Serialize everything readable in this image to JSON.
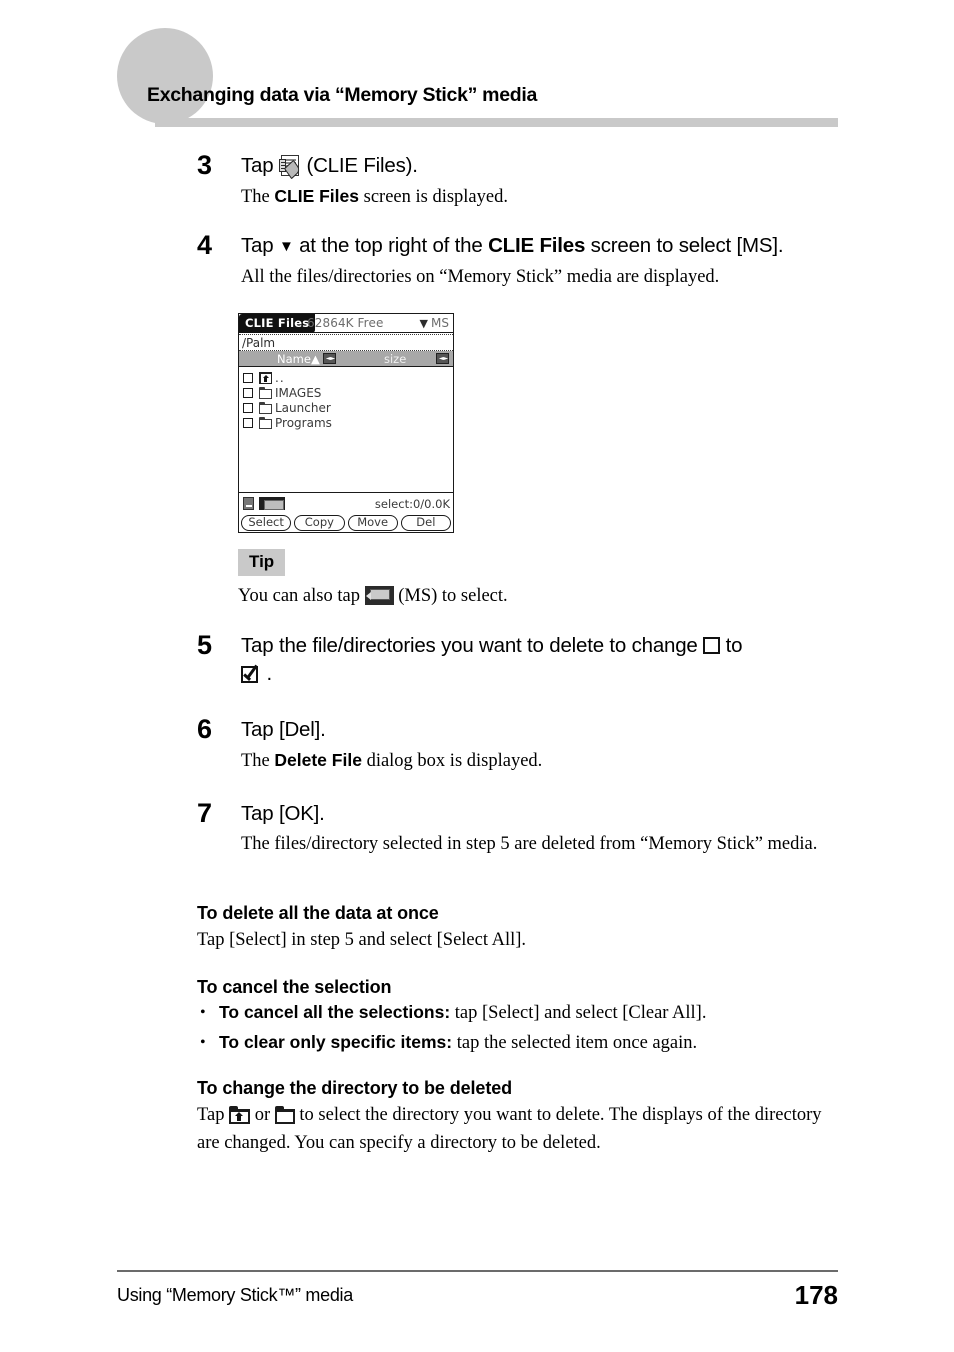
{
  "header": {
    "title": "Exchanging data via “Memory Stick” media"
  },
  "steps": [
    {
      "number": "3",
      "head_pre": "Tap",
      "head_post": "(CLIE Files).",
      "desc_pre": "The ",
      "desc_bold": "CLIE Files",
      "desc_post": " screen is displayed."
    },
    {
      "number": "4",
      "head_pre": "Tap",
      "head_mid": "at the top right of the",
      "head_bold": "CLIE Files",
      "head_post": "screen to select [MS].",
      "desc": "All the files/directories on “Memory Stick” media are displayed."
    },
    {
      "number": "5",
      "head_pre": "Tap the file/directories you want to delete to change",
      "head_mid": "to",
      "head_post": "."
    },
    {
      "number": "6",
      "head": "Tap [Del].",
      "desc_pre": "The ",
      "desc_bold": "Delete File",
      "desc_post": " dialog box is displayed."
    },
    {
      "number": "7",
      "head": "Tap [OK].",
      "desc": "The files/directory selected in step 5 are deleted from “Memory Stick” media."
    }
  ],
  "pda": {
    "title": "CLIE Files",
    "free_space": "62864K Free",
    "card_label": "MS",
    "path": "/Palm",
    "columns": {
      "name": "Name",
      "sort_arrow": "▲",
      "size": "size"
    },
    "rows": [
      {
        "label": "..",
        "icon": "parent-folder-icon",
        "checked": false
      },
      {
        "label": "IMAGES",
        "icon": "folder-icon",
        "checked": false
      },
      {
        "label": "Launcher",
        "icon": "folder-icon",
        "checked": false
      },
      {
        "label": "Programs",
        "icon": "folder-icon",
        "checked": false
      }
    ],
    "status": "select:0/0.0K",
    "buttons": [
      "Select",
      "Copy",
      "Move",
      "Del"
    ]
  },
  "tip": {
    "label": "Tip",
    "text_pre": "You can also tap",
    "text_post": "(MS) to select."
  },
  "sections": [
    {
      "heading": "To delete all the data at once",
      "paragraph": "Tap [Select] in step 5 and select [Select All]."
    },
    {
      "heading": "To cancel the selection",
      "bullets": [
        {
          "bold": "To cancel all the selections:",
          "rest": " tap [Select] and select [Clear All]."
        },
        {
          "bold": "To clear only specific items:",
          "rest": " tap the selected item once again."
        }
      ]
    },
    {
      "heading": "To change the directory to be deleted",
      "para_pre": "Tap",
      "para_mid": "or",
      "para_post": "to select the directory you want to delete. The displays of the directory are changed. You can specify a directory to be deleted."
    }
  ],
  "footer": {
    "left": "Using “Memory Stick™” media",
    "page": "178"
  }
}
